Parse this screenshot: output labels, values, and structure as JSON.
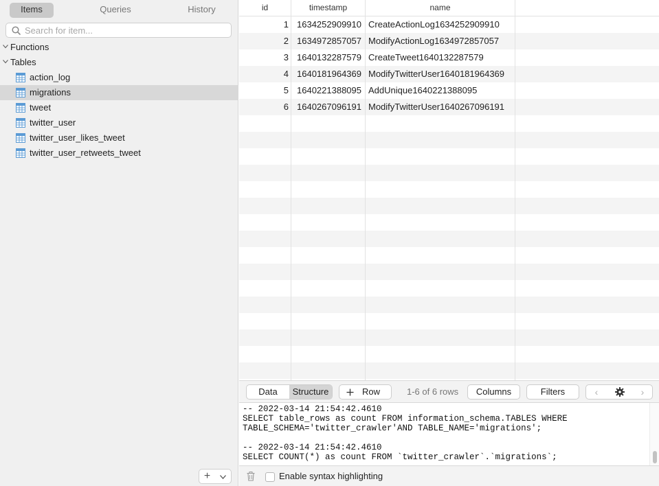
{
  "sidebar": {
    "tabs": [
      "Items",
      "Queries",
      "History"
    ],
    "search_placeholder": "Search for item...",
    "groups": {
      "functions": "Functions",
      "tables": "Tables"
    },
    "tables": [
      "action_log",
      "migrations",
      "tweet",
      "twitter_user",
      "twitter_user_likes_tweet",
      "twitter_user_retweets_tweet"
    ],
    "selected_table": "migrations",
    "add_button": "+",
    "add_menu": "chevron-down"
  },
  "grid": {
    "columns": [
      "id",
      "timestamp",
      "name"
    ],
    "rows": [
      [
        "1",
        "1634252909910",
        "CreateActionLog1634252909910"
      ],
      [
        "2",
        "1634972857057",
        "ModifyActionLog1634972857057"
      ],
      [
        "3",
        "1640132287579",
        "CreateTweet1640132287579"
      ],
      [
        "4",
        "1640181964369",
        "ModifyTwitterUser1640181964369"
      ],
      [
        "5",
        "1640221388095",
        "AddUnique1640221388095"
      ],
      [
        "6",
        "1640267096191",
        "ModifyTwitterUser1640267096191"
      ]
    ]
  },
  "toolbar": {
    "data_tab": "Data",
    "structure_tab": "Structure",
    "row_button": "Row",
    "rows_count": "1-6 of 6 rows",
    "columns_button": "Columns",
    "filters_button": "Filters",
    "prev_glyph": "‹",
    "next_glyph": "›"
  },
  "console": {
    "log": "-- 2022-03-14 21:54:42.4610\nSELECT table_rows as count FROM information_schema.TABLES WHERE\nTABLE_SCHEMA='twitter_crawler'AND TABLE_NAME='migrations';\n\n-- 2022-03-14 21:54:42.4610\nSELECT COUNT(*) as count FROM `twitter_crawler`.`migrations`;"
  },
  "footer": {
    "syntax_label": "Enable syntax highlighting",
    "syntax_checked": false
  },
  "colors": {
    "table_icon": "#5b9bd5",
    "selected_row": "#d8d8d8",
    "sidebar_bg": "#f0f0f0"
  }
}
